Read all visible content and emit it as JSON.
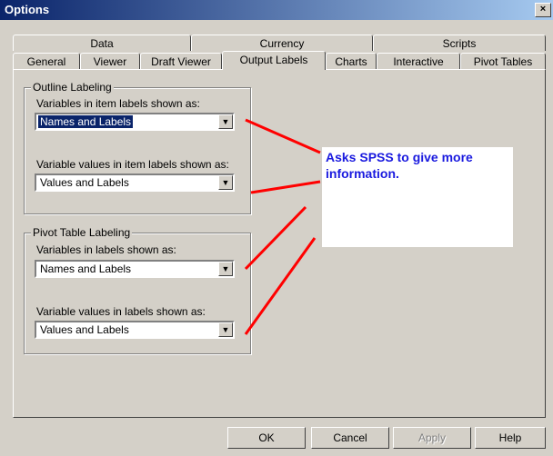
{
  "window": {
    "title": "Options",
    "close_glyph": "×"
  },
  "tabs_back_row": [
    "Data",
    "Currency",
    "Scripts"
  ],
  "tabs_front_row": [
    "General",
    "Viewer",
    "Draft Viewer",
    "Output Labels",
    "Charts",
    "Interactive",
    "Pivot Tables"
  ],
  "active_tab": "Output Labels",
  "outline": {
    "group_label": "Outline Labeling",
    "var_label": "Variables in item labels shown as:",
    "var_value": "Names and Labels",
    "val_label": "Variable values in item labels shown as:",
    "val_value": "Values and Labels"
  },
  "pivot": {
    "group_label": "Pivot Table Labeling",
    "var_label": "Variables in labels shown as:",
    "var_value": "Names and Labels",
    "val_label": "Variable values in labels shown as:",
    "val_value": "Values and Labels"
  },
  "note": {
    "text": "Asks SPSS to give more information."
  },
  "buttons": {
    "ok": "OK",
    "cancel": "Cancel",
    "apply": "Apply",
    "help": "Help"
  },
  "colors": {
    "annotation_text": "#1a1adf",
    "annotation_lines": "#ff0000",
    "title_bar": "#0a246a"
  }
}
